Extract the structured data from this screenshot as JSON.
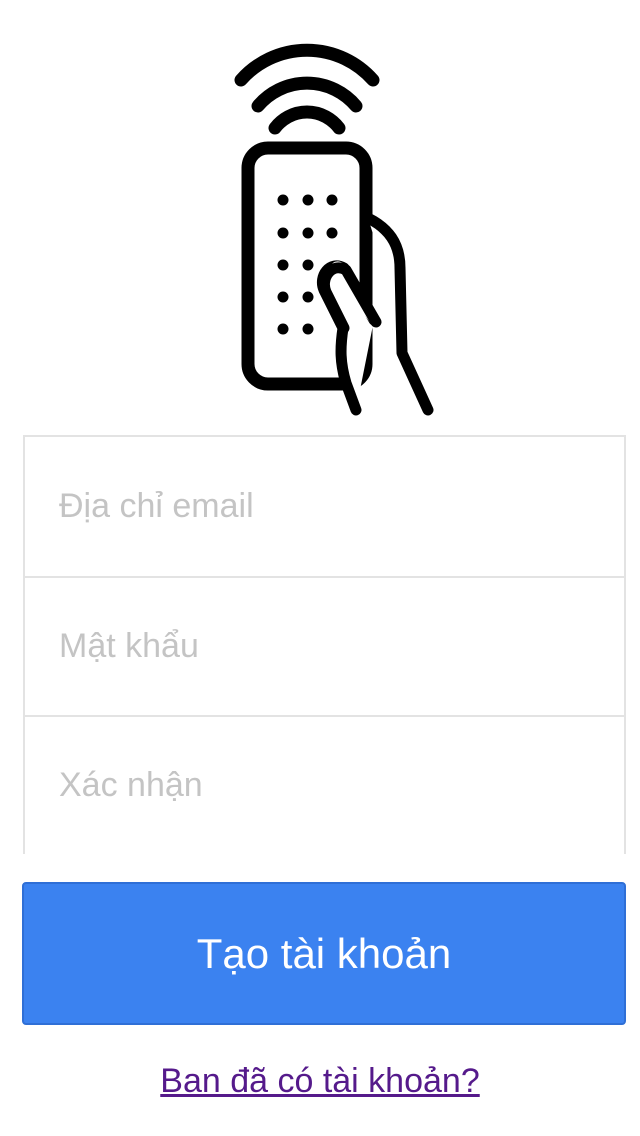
{
  "logo": {
    "icon": "remote-control-hand-icon",
    "color": "#000000"
  },
  "form": {
    "email": {
      "placeholder": "Địa chỉ email",
      "value": ""
    },
    "password": {
      "placeholder": "Mật khẩu",
      "value": ""
    },
    "confirm": {
      "placeholder": "Xác nhận",
      "value": ""
    }
  },
  "actions": {
    "create_account_label": "Tạo tài khoản",
    "have_account_link": "Ban đã có tài khoản?"
  },
  "colors": {
    "primary_button": "#3b82f0",
    "link": "#551a8b",
    "border": "#e3e3e3",
    "placeholder": "#c4c4c4"
  }
}
